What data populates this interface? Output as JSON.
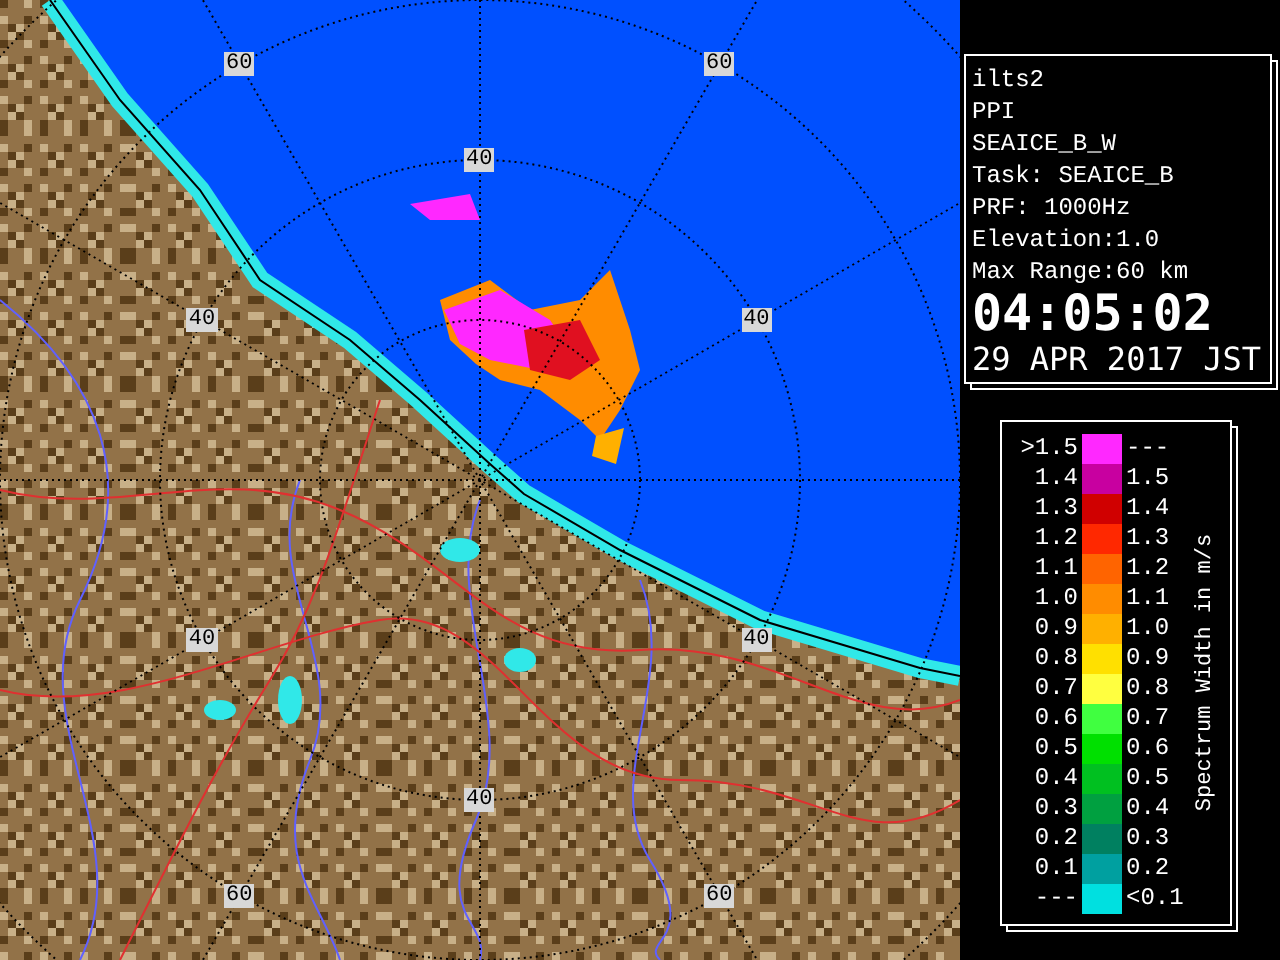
{
  "map": {
    "rings": [
      {
        "labels": [
          "40",
          "40",
          "40",
          "40",
          "40",
          "40"
        ]
      },
      {
        "labels": [
          "60",
          "60",
          "60",
          "60"
        ]
      }
    ]
  },
  "info": {
    "lines": [
      "ilts2",
      "PPI",
      "SEAICE_B_W",
      "Task: SEAICE_B",
      "PRF: 1000Hz",
      "Elevation:1.0",
      "Max Range:60 km"
    ],
    "time": "04:05:02",
    "date": "29 APR 2017 JST"
  },
  "legend": {
    "title": "Spectrum Width in m/s",
    "rows": [
      {
        "low": ">1.5",
        "high": "---",
        "color": "#ff28ff"
      },
      {
        "low": "1.4",
        "high": "1.5",
        "color": "#c800a0"
      },
      {
        "low": "1.3",
        "high": "1.4",
        "color": "#d00000"
      },
      {
        "low": "1.2",
        "high": "1.3",
        "color": "#ff2800"
      },
      {
        "low": "1.1",
        "high": "1.2",
        "color": "#ff6400"
      },
      {
        "low": "1.0",
        "high": "1.1",
        "color": "#ff8c00"
      },
      {
        "low": "0.9",
        "high": "1.0",
        "color": "#ffb000"
      },
      {
        "low": "0.8",
        "high": "0.9",
        "color": "#ffe000"
      },
      {
        "low": "0.7",
        "high": "0.8",
        "color": "#ffff40"
      },
      {
        "low": "0.6",
        "high": "0.7",
        "color": "#40ff40"
      },
      {
        "low": "0.5",
        "high": "0.6",
        "color": "#00e000"
      },
      {
        "low": "0.4",
        "high": "0.5",
        "color": "#00c020"
      },
      {
        "low": "0.3",
        "high": "0.4",
        "color": "#00a040"
      },
      {
        "low": "0.2",
        "high": "0.3",
        "color": "#008060"
      },
      {
        "low": "0.1",
        "high": "0.2",
        "color": "#00a0a0"
      },
      {
        "low": "---",
        "high": "<0.1",
        "color": "#00e0e0"
      }
    ]
  }
}
